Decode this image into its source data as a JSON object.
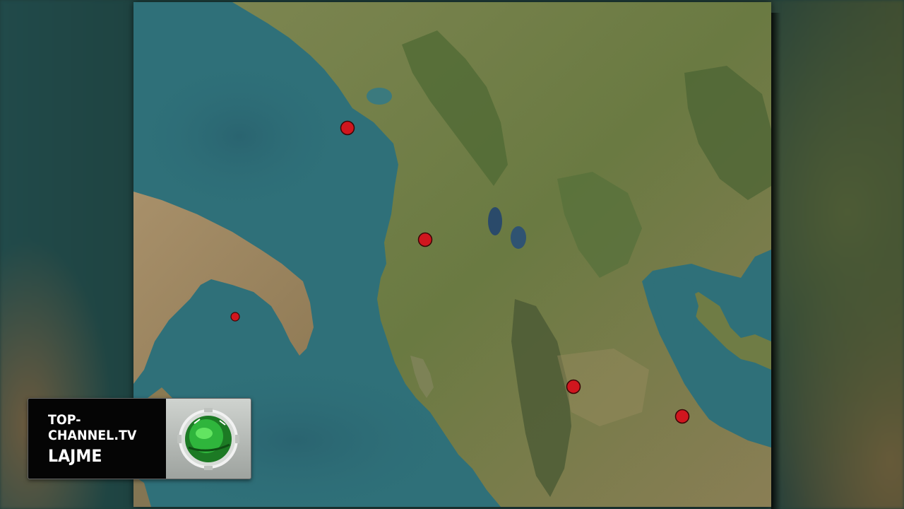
{
  "broadcast": {
    "site": "TOP-CHANNEL.TV",
    "show": "LAJME"
  },
  "map": {
    "colors": {
      "sea": "#2e6f78",
      "deep_sea": "#2a6470",
      "land": "#6e7a47",
      "land_dry": "#9c8f66",
      "mountain": "#4f6a34",
      "marker_fill": "#d0161e",
      "marker_stroke": "#3a0606"
    },
    "markers": [
      {
        "id": "quake-1"
      },
      {
        "id": "quake-2"
      },
      {
        "id": "quake-3"
      },
      {
        "id": "quake-4"
      },
      {
        "id": "quake-5"
      }
    ]
  }
}
